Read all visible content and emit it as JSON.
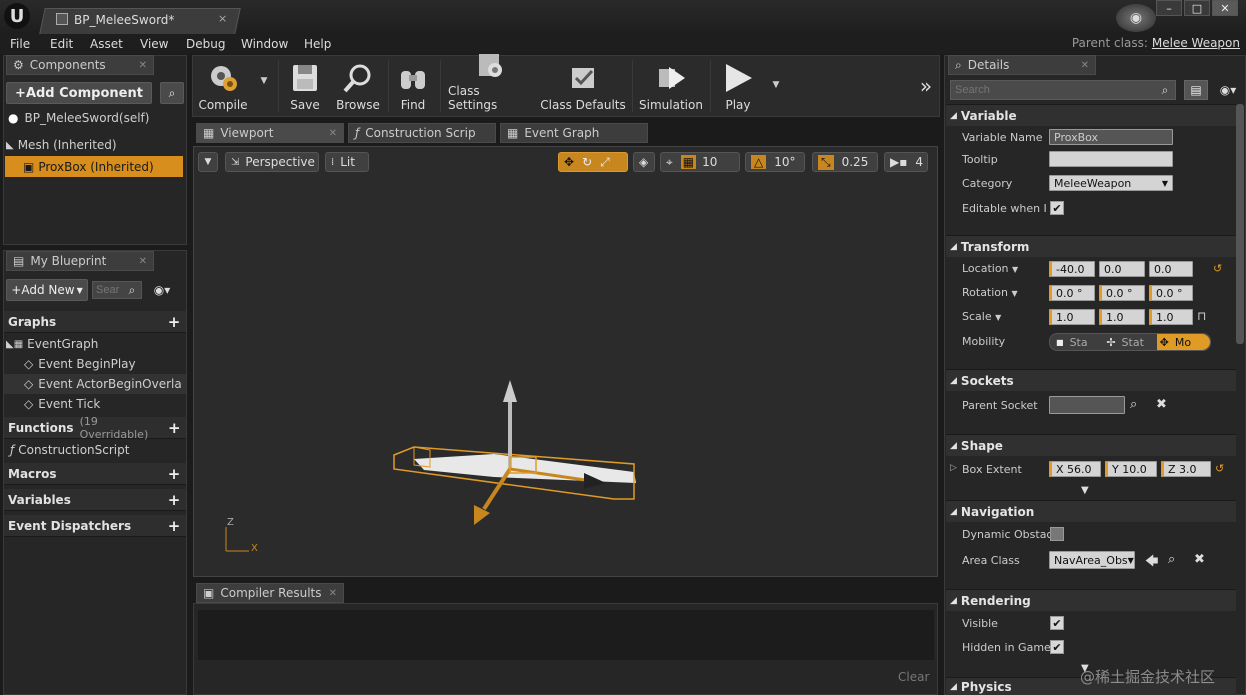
{
  "titlebar": {
    "tab_title": "BP_MeleeSword*",
    "close": "×",
    "logo": "U",
    "win_min": "–",
    "win_max": "□",
    "win_close": "✕"
  },
  "menu": {
    "items": [
      "File",
      "Edit",
      "Asset",
      "View",
      "Debug",
      "Window",
      "Help"
    ],
    "parent_class_label": "Parent class:",
    "parent_class_value": "Melee Weapon"
  },
  "components": {
    "tab": "Components",
    "add_component": "+Add Component",
    "self_item": "BP_MeleeSword(self)",
    "tree": [
      {
        "label": "Mesh (Inherited)"
      },
      {
        "label": "ProxBox (Inherited)",
        "selected": true
      }
    ]
  },
  "my_blueprint": {
    "tab": "My Blueprint",
    "add_new": "Add New",
    "search_placeholder": "Sear",
    "graphs_header": "Graphs",
    "event_graph": "EventGraph",
    "events": [
      "Event BeginPlay",
      "Event ActorBeginOverla",
      "Event Tick"
    ],
    "functions_header": "Functions",
    "functions_count": "(19 Overridable)",
    "construction_script": "ConstructionScript",
    "macros_header": "Macros",
    "variables_header": "Variables",
    "dispatchers_header": "Event Dispatchers"
  },
  "toolbar": {
    "compile": "Compile",
    "save": "Save",
    "browse": "Browse",
    "find": "Find",
    "class_settings": "Class Settings",
    "class_defaults": "Class Defaults",
    "simulation": "Simulation",
    "play": "Play",
    "more": "»"
  },
  "editor_tabs": [
    "Viewport",
    "Construction Scrip",
    "Event Graph"
  ],
  "viewport": {
    "perspective": "Perspective",
    "lit": "Lit",
    "grid_snap": "10",
    "rot_snap": "10°",
    "scale_snap": "0.25",
    "cam_speed": "4",
    "axis_z": "Z",
    "axis_x": "X"
  },
  "compiler": {
    "tab": "Compiler Results",
    "clear": "Clear"
  },
  "details": {
    "tab": "Details",
    "search_placeholder": "Search",
    "variable": {
      "header": "Variable",
      "name_label": "Variable Name",
      "name_value": "ProxBox",
      "tooltip_label": "Tooltip",
      "category_label": "Category",
      "category_value": "MeleeWeapon",
      "editable_label": "Editable when Inl"
    },
    "transform": {
      "header": "Transform",
      "location_label": "Location",
      "rotation_label": "Rotation",
      "scale_label": "Scale",
      "mobility_label": "Mobility",
      "location": [
        "-40.0",
        "0.0",
        "0.0"
      ],
      "rotation": [
        "0.0 °",
        "0.0 °",
        "0.0 °"
      ],
      "scale": [
        "1.0",
        "1.0",
        "1.0"
      ],
      "mobility": [
        "Sta",
        "Stat",
        "Mo"
      ]
    },
    "sockets": {
      "header": "Sockets",
      "parent_socket_label": "Parent Socket"
    },
    "shape": {
      "header": "Shape",
      "box_extent_label": "Box Extent",
      "x": "X  56.0",
      "y": "Y  10.0",
      "z": "Z  3.0"
    },
    "navigation": {
      "header": "Navigation",
      "dynamic_label": "Dynamic Obstac",
      "area_class_label": "Area Class",
      "area_class_value": "NavArea_Obs"
    },
    "rendering": {
      "header": "Rendering",
      "visible_label": "Visible",
      "hidden_label": "Hidden in Game"
    },
    "physics": {
      "header": "Physics"
    }
  },
  "watermark": "@稀土掘金技术社区",
  "colors": {
    "accent": "#e09a26",
    "selected_row": "#d78e1d",
    "bg": "#1b1b1b",
    "panel": "#262626"
  }
}
